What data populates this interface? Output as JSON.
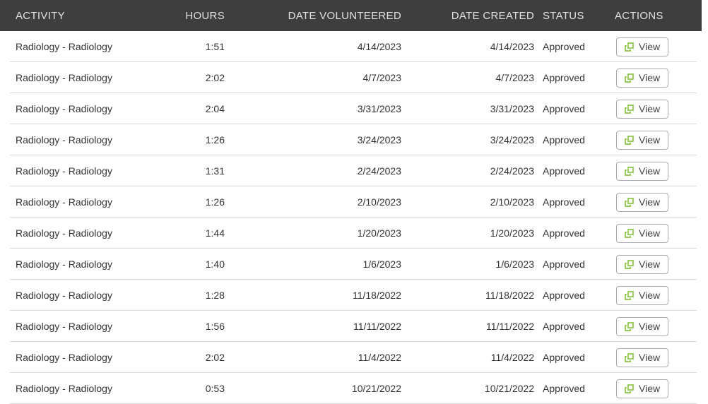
{
  "table": {
    "columns": [
      {
        "key": "activity",
        "label": "ACTIVITY"
      },
      {
        "key": "hours",
        "label": "HOURS"
      },
      {
        "key": "date_volunteered",
        "label": "DATE VOLUNTEERED"
      },
      {
        "key": "date_created",
        "label": "DATE CREATED"
      },
      {
        "key": "status",
        "label": "STATUS"
      },
      {
        "key": "actions",
        "label": "ACTIONS"
      }
    ],
    "view_button_label": "View",
    "rows": [
      {
        "activity": "Radiology - Radiology",
        "hours": "1:51",
        "date_volunteered": "4/14/2023",
        "date_created": "4/14/2023",
        "status": "Approved"
      },
      {
        "activity": "Radiology - Radiology",
        "hours": "2:02",
        "date_volunteered": "4/7/2023",
        "date_created": "4/7/2023",
        "status": "Approved"
      },
      {
        "activity": "Radiology - Radiology",
        "hours": "2:04",
        "date_volunteered": "3/31/2023",
        "date_created": "3/31/2023",
        "status": "Approved"
      },
      {
        "activity": "Radiology - Radiology",
        "hours": "1:26",
        "date_volunteered": "3/24/2023",
        "date_created": "3/24/2023",
        "status": "Approved"
      },
      {
        "activity": "Radiology - Radiology",
        "hours": "1:31",
        "date_volunteered": "2/24/2023",
        "date_created": "2/24/2023",
        "status": "Approved"
      },
      {
        "activity": "Radiology - Radiology",
        "hours": "1:26",
        "date_volunteered": "2/10/2023",
        "date_created": "2/10/2023",
        "status": "Approved"
      },
      {
        "activity": "Radiology - Radiology",
        "hours": "1:44",
        "date_volunteered": "1/20/2023",
        "date_created": "1/20/2023",
        "status": "Approved"
      },
      {
        "activity": "Radiology - Radiology",
        "hours": "1:40",
        "date_volunteered": "1/6/2023",
        "date_created": "1/6/2023",
        "status": "Approved"
      },
      {
        "activity": "Radiology - Radiology",
        "hours": "1:28",
        "date_volunteered": "11/18/2022",
        "date_created": "11/18/2022",
        "status": "Approved"
      },
      {
        "activity": "Radiology - Radiology",
        "hours": "1:56",
        "date_volunteered": "11/11/2022",
        "date_created": "11/11/2022",
        "status": "Approved"
      },
      {
        "activity": "Radiology - Radiology",
        "hours": "2:02",
        "date_volunteered": "11/4/2022",
        "date_created": "11/4/2022",
        "status": "Approved"
      },
      {
        "activity": "Radiology - Radiology",
        "hours": "0:53",
        "date_volunteered": "10/21/2022",
        "date_created": "10/21/2022",
        "status": "Approved"
      }
    ]
  },
  "colors": {
    "header_bg": "#3e3e3e",
    "header_text": "#e2e2e2",
    "row_text": "#333333",
    "separator": "#d9d9d9",
    "button_border": "#ababab",
    "button_text": "#444444",
    "icon_green": "#8bc53f"
  }
}
